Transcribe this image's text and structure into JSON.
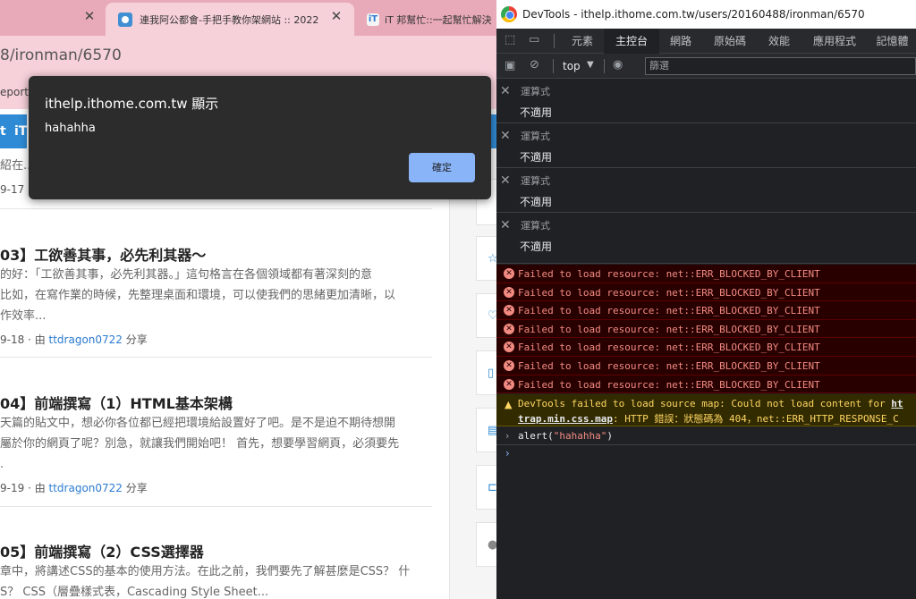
{
  "browser": {
    "tabs": [
      {
        "title": "",
        "close": "✕"
      },
      {
        "title": "連我阿公都會-手把手教你架網站 :: 2022",
        "close": "✕"
      },
      {
        "title": "iT 邦幫忙::一起幫忙解決",
        "close": ""
      }
    ],
    "address": "8/ironman/6570",
    "bookmarks_text": "eporta"
  },
  "site_nav": {
    "item1": "t",
    "item2": "iT"
  },
  "articles": [
    {
      "title": "",
      "excerpt": [
        "紹在..."
      ],
      "meta_date": "9-17 ·",
      "meta_by": "",
      "meta_author": "",
      "meta_share": ""
    },
    {
      "title": "03】工欲善其事，必先利其器～",
      "excerpt": [
        "的好：「工欲善其事，必先利其器。」這句格言在各個領域都有著深刻的意",
        "比如，在寫作業的時候，先整理桌面和環境，可以使我們的思緒更加清晰，以",
        "作效率..."
      ],
      "meta_date": "9-18 · ",
      "meta_by": "由 ",
      "meta_author": "ttdragon0722",
      "meta_share": " 分享"
    },
    {
      "title": "04】前端撰寫（1）HTML基本架構",
      "excerpt": [
        "天篇的貼文中，想必你各位都已經把環境給設置好了吧。是不是迫不期待想開",
        "屬於你的網頁了呢？別急，就讓我們開始吧！ 首先，想要學習網頁，必須要先",
        "."
      ],
      "meta_date": "9-19 · ",
      "meta_by": "由 ",
      "meta_author": "ttdragon0722",
      "meta_share": " 分享"
    },
    {
      "title": "05】前端撰寫（2）CSS選擇器",
      "excerpt": [
        "章中，將講述CSS的基本的使用方法。在此之前，我們要先了解甚麼是CSS？ 什",
        "S？ CSS（層疊樣式表，Cascading Style Sheet..."
      ],
      "meta_date": "",
      "meta_by": "",
      "meta_author": "",
      "meta_share": ""
    }
  ],
  "alert": {
    "title": "ithelp.ithome.com.tw 顯示",
    "message": "hahahha",
    "ok_label": "確定"
  },
  "devtools": {
    "window_title": "DevTools - ithelp.ithome.com.tw/users/20160488/ironman/6570",
    "tabs": [
      "元素",
      "主控台",
      "網路",
      "原始碼",
      "效能",
      "應用程式",
      "記憶體"
    ],
    "active_tab": "主控台",
    "context": "top",
    "filter_placeholder": "篩選",
    "watch_expressions": [
      {
        "label": "運算式",
        "value": "不適用"
      },
      {
        "label": "運算式",
        "value": "不適用"
      },
      {
        "label": "運算式",
        "value": "不適用"
      },
      {
        "label": "運算式",
        "value": "不適用"
      }
    ],
    "errors": [
      "Failed to load resource: net::ERR_BLOCKED_BY_CLIENT",
      "Failed to load resource: net::ERR_BLOCKED_BY_CLIENT",
      "Failed to load resource: net::ERR_BLOCKED_BY_CLIENT",
      "Failed to load resource: net::ERR_BLOCKED_BY_CLIENT",
      "Failed to load resource: net::ERR_BLOCKED_BY_CLIENT",
      "Failed to load resource: net::ERR_BLOCKED_BY_CLIENT",
      "Failed to load resource: net::ERR_BLOCKED_BY_CLIENT"
    ],
    "warning": {
      "line1": "DevTools failed to load source map: Could not load content for ",
      "line1_link": "ht",
      "line2_link": "trap.min.css.map",
      "line2": ": HTTP 錯誤：狀態碼為 404，net::ERR_HTTP_RESPONSE_C"
    },
    "command": {
      "fn": "alert(",
      "arg": "\"hahahha\"",
      "close": ")"
    },
    "colors": {
      "error_bg": "#290000",
      "error_text": "#f28b82",
      "warning_text": "#fdd663",
      "active_tab_bg": "#202124"
    }
  }
}
